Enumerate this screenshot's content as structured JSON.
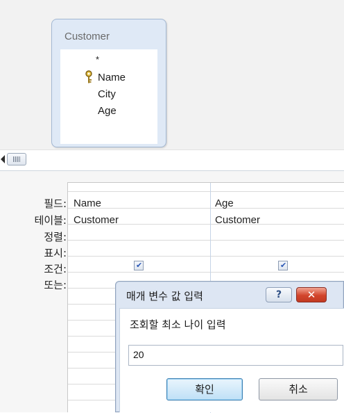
{
  "table": {
    "title": "Customer",
    "fields": [
      "*",
      "Name",
      "City",
      "Age"
    ],
    "primary_key_field": "Name"
  },
  "grid": {
    "row_labels": [
      "필드:",
      "테이블:",
      "정렬:",
      "표시:",
      "조건:",
      "또는:"
    ],
    "columns": [
      {
        "field": "Name",
        "table": "Customer",
        "show": true
      },
      {
        "field": "Age",
        "table": "Customer",
        "show": true
      }
    ]
  },
  "dialog": {
    "title": "매개 변수 값 입력",
    "help_label": "?",
    "close_label": "✕",
    "prompt": "조회할 최소 나이 입력",
    "value": "20",
    "ok_label": "확인",
    "cancel_label": "취소"
  },
  "colors": {
    "table_box_bg": "#dfe9f6",
    "close_button": "#d2452c",
    "ok_border": "#3c7fb1"
  },
  "icons": [
    "key-icon",
    "checkmark-icon",
    "scroll-left-icon",
    "scroll-grip-icon"
  ]
}
